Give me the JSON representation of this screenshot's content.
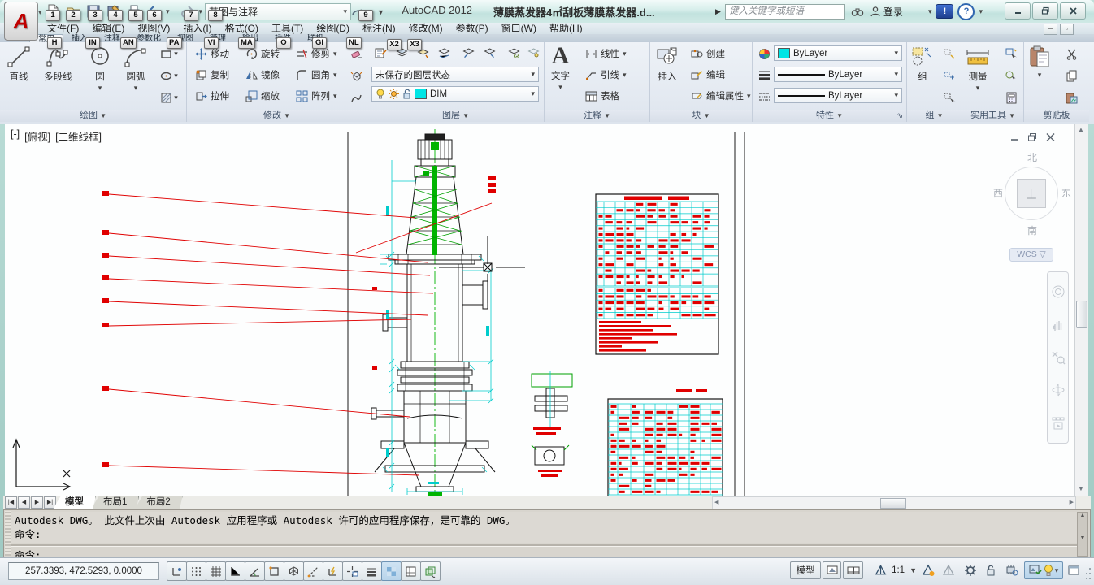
{
  "window": {
    "product": "AutoCAD 2012",
    "document": "薄膜蒸发器4㎡刮板薄膜蒸发器.d...",
    "search_placeholder": "键入关键字或短语",
    "signin_label": "登录",
    "exchange_label": "!",
    "help_label": "?"
  },
  "qat": {
    "workspace": "草图与注释"
  },
  "keytips": {
    "q1": "1",
    "q2": "2",
    "q3": "3",
    "q4": "4",
    "q5": "5",
    "q6": "6",
    "q7": "7",
    "q8": "8",
    "q9": "9",
    "h": "H",
    "in": "IN",
    "an": "AN",
    "pa": "PA",
    "vi": "VI",
    "ma": "MA",
    "o": "O",
    "gi": "GI",
    "nl": "NL",
    "x2": "X2",
    "x3": "X3"
  },
  "menu": {
    "items": [
      "文件(F)",
      "编辑(E)",
      "视图(V)",
      "插入(I)",
      "格式(O)",
      "工具(T)",
      "绘图(D)",
      "标注(N)",
      "修改(M)",
      "参数(P)",
      "窗口(W)",
      "帮助(H)"
    ]
  },
  "ribbon_tabs": [
    "常用",
    "插入",
    "注释",
    "参数化",
    "视图",
    "管理",
    "输出",
    "插件",
    "联机"
  ],
  "ribbon": {
    "draw": {
      "label": "绘图",
      "line": "直线",
      "polyline": "多段线",
      "circle": "圆",
      "arc": "圆弧"
    },
    "modify": {
      "label": "修改",
      "move": "移动",
      "rotate": "旋转",
      "trim": "修剪",
      "copy": "复制",
      "mirror": "镜像",
      "fillet": "圆角",
      "stretch": "拉伸",
      "scale": "缩放",
      "array": "阵列"
    },
    "layers": {
      "label": "图层",
      "state": "未保存的图层状态",
      "layer_name": "DIM"
    },
    "annotate": {
      "label": "注释",
      "text": "文字",
      "linear": "线性",
      "leader": "引线",
      "table": "表格"
    },
    "block": {
      "label": "块",
      "insert": "插入",
      "create": "创建",
      "edit": "编辑",
      "edit_attr": "编辑属性"
    },
    "properties": {
      "label": "特性",
      "color": "ByLayer",
      "lineweight": "ByLayer",
      "linetype": "ByLayer"
    },
    "groups": {
      "label": "组",
      "group": "组"
    },
    "utilities": {
      "label": "实用工具",
      "measure": "测量"
    },
    "clipboard": {
      "label": "剪贴板",
      "paste": "粘贴"
    }
  },
  "viewport": {
    "minus": "[-]",
    "view": "[俯视]",
    "visual": "[二维线框]"
  },
  "viewcube": {
    "north": "北",
    "south": "南",
    "west": "西",
    "east": "东",
    "top": "上",
    "wcs": "WCS"
  },
  "layout_tabs": {
    "model": "模型",
    "layout1": "布局1",
    "layout2": "布局2"
  },
  "command": {
    "line1": "Autodesk DWG。  此文件上次由 Autodesk 应用程序或 Autodesk 许可的应用程序保存，是可靠的 DWG。",
    "line2": "命令:",
    "input": "命令:"
  },
  "status": {
    "coords": "257.3393, 472.5293, 0.0000",
    "model_btn": "模型",
    "scale": "1:1"
  },
  "colors": {
    "centerline": "#00b400",
    "dimension": "#00cccc",
    "leader": "#e00000",
    "layer_swatch": "#00e5e5"
  }
}
